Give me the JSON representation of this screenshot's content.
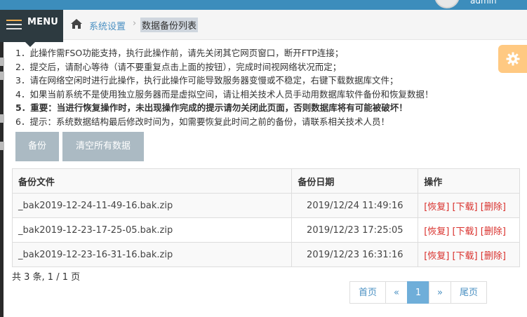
{
  "header": {
    "brand": "ሞቨዡ",
    "user": "admin"
  },
  "menu": {
    "label": "MENU"
  },
  "breadcrumb": {
    "link": "系统设置",
    "separator": "›",
    "current": "数据备份列表"
  },
  "notes": [
    "1．此操作需FSO功能支持，执行此操作前，请先关闭其它网页窗口，断开FTP连接；",
    "2．提交后，请耐心等待（请不要重复点击上面的按钮），完成时间视网络状况而定；",
    "3．请在网络空闲时进行此操作，执行此操作可能导致服务器变慢或不稳定，右键下载数据库文件；",
    "4．如果当前系统不是使用独立服务器而是虚拟空间，请让相关技术人员手动用数据库软件备份和恢复数据！",
    "5．重要：当进行恢复操作时，未出现操作完成的提示请勿关闭此页面，否则数据库将有可能被破坏！",
    "6．提示：系统数据结构最后修改时间为，如需要恢复此时间之前的备份，请联系相关技术人员！"
  ],
  "buttons": {
    "backup": "备份",
    "clear_all": "清空所有数据"
  },
  "table": {
    "headers": [
      "备份文件",
      "备份日期",
      "操作"
    ],
    "rows": [
      {
        "file": "_bak2019-12-24-11-49-16.bak.zip",
        "date": "2019/12/24 11:49:16",
        "restore": "[恢复]",
        "download": "[下载]",
        "delete": "[删除]"
      },
      {
        "file": "_bak2019-12-23-17-25-05.bak.zip",
        "date": "2019/12/23 17:25:05",
        "restore": "[恢复]",
        "download": "[下载]",
        "delete": "[删除]"
      },
      {
        "file": "_bak2019-12-23-16-31-16.bak.zip",
        "date": "2019/12/23 16:31:16",
        "restore": "[恢复]",
        "download": "[下载]",
        "delete": "[删除]"
      }
    ]
  },
  "summary": "共 3 条, 1 / 1 页",
  "pager": {
    "first": "首页",
    "prev": "«",
    "current": "1",
    "next": "»",
    "last": "尾页"
  },
  "colors": {
    "header_blue": "#3c8dbc",
    "menu_dark": "#2d3a40",
    "button_gray": "#abbac3",
    "link_blue": "#4a90c2",
    "danger_red": "#d9302c",
    "gear_orange": "#ffc982"
  },
  "icons": {
    "home": "home-icon",
    "gear": "gear-icon",
    "menu": "hamburger-icon"
  }
}
